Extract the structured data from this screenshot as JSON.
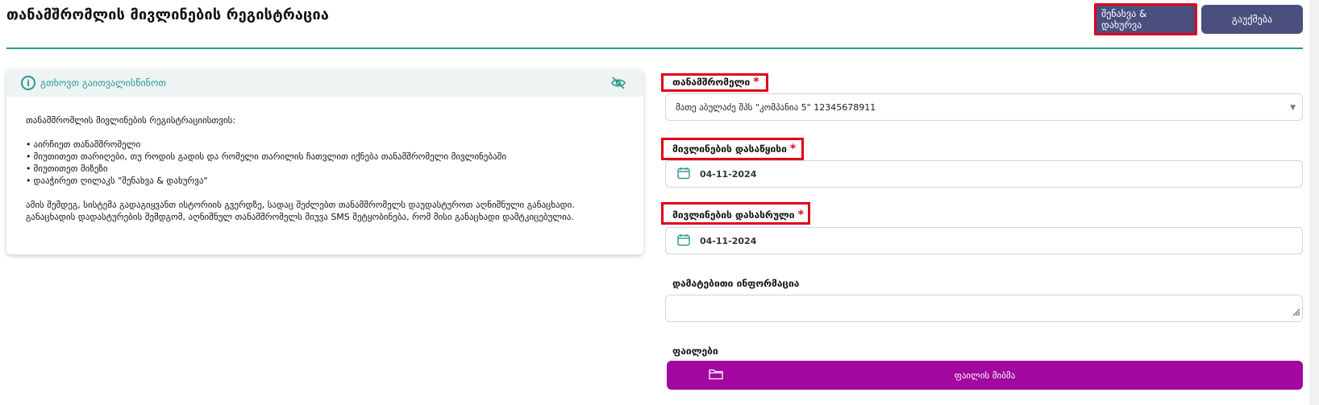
{
  "header": {
    "title": "თანამშრომლის მივლინების რეგისტრაცია",
    "save_button": "შენახვა & დახურვა",
    "cancel_button": "გაუქმება"
  },
  "info": {
    "title": "გთხოვთ გაითვალისწინოთ",
    "intro": "თანამშრომლის მივლინების რეგისტრაციისთვის:",
    "steps": [
      "აირჩიეთ თანამშრომელი",
      "მიუთითეთ თარიღები, თუ როდის გადის და რომელი თარილის ჩათვლით იქნება თანამშრომელი მივლინებაში",
      "მიუთითეთ მიზეზი",
      "დააჭირეთ ღილაკს \"შენახვა & დახურვა\""
    ],
    "outro": "ამის შემდეგ, სისტემა გადაგიყვანთ ისტორიის გვერდზე, სადაც შეძლებთ თანამშრომელს დაუდასტუროთ აღნიშნული განაცხადი. განაცხადის დადასტურების შემდგომ, აღნიშნულ თანამშრომელს მიუვა SMS შეტყობინება, რომ მისი განაცხადი დამტკიცებულია."
  },
  "form": {
    "employee_label": "თანამშრომელი",
    "employee_value": "მათე აბულაძე შპს \"კომპანია 5\" 12345678911",
    "start_label": "მივლინების დასაწყისი",
    "start_value": "04-11-2024",
    "end_label": "მივლინების დასასრული",
    "end_value": "04-11-2024",
    "additional_label": "დამატებითი ინფორმაცია",
    "additional_value": "",
    "files_label": "ფაილები",
    "upload_label": "ფაილის მიბმა",
    "required_mark": "*"
  },
  "colors": {
    "accent": "#2a9a8f",
    "button": "#4a4f7e",
    "upload": "#a2079f",
    "required": "#e0001a"
  }
}
